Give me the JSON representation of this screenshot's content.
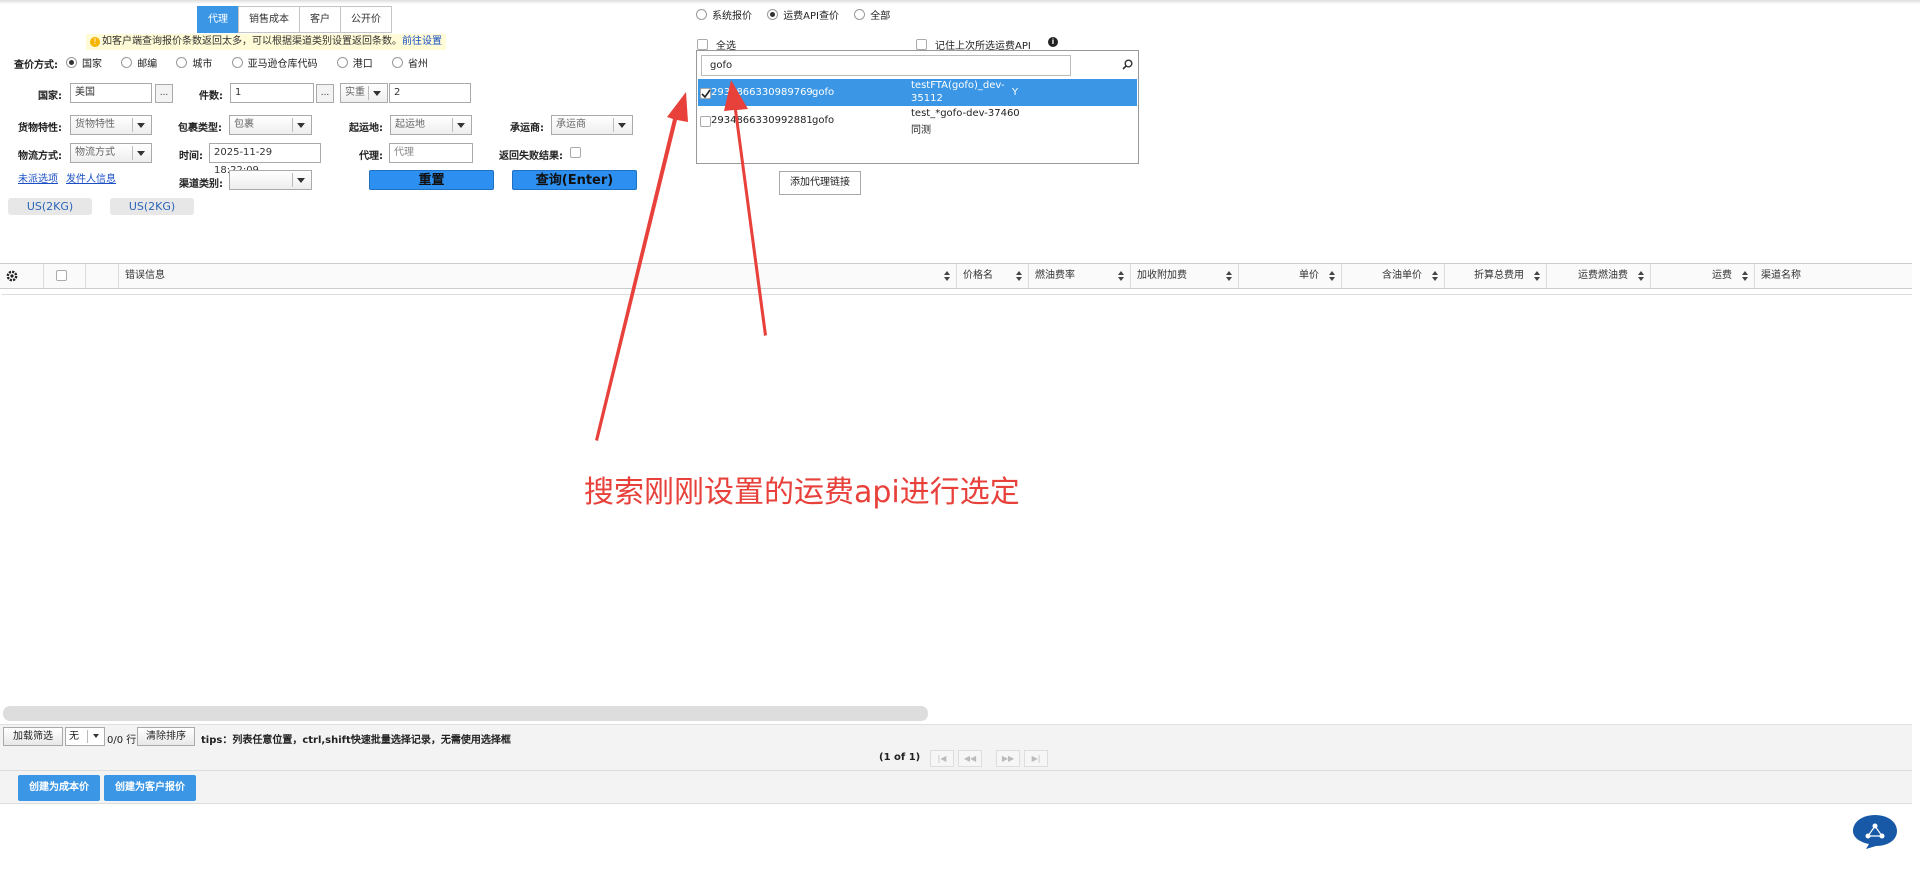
{
  "tabs": [
    "代理",
    "销售成本",
    "客户",
    "公开价"
  ],
  "notice": {
    "text": "如客户端查询报价条数返回太多，可以根据渠道类别设置返回条数。",
    "link": "前往设置"
  },
  "query_mode": {
    "label": "查价方式:",
    "options": [
      "国家",
      "邮编",
      "城市",
      "亚马逊仓库代码",
      "港口",
      "省州"
    ],
    "selected": "国家"
  },
  "form": {
    "country_label": "国家:",
    "country_value": "美国",
    "pieces_label": "件数:",
    "pieces_value": "1",
    "weight_type": "实重",
    "weight_value": "2",
    "cargo_label": "货物特性:",
    "cargo_ph": "货物特性",
    "package_label": "包裹类型:",
    "package_value": "包裹",
    "origin_label": "起运地:",
    "origin_ph": "起运地",
    "carrier_label": "承运商:",
    "carrier_ph": "承运商",
    "logistics_label": "物流方式:",
    "logistics_ph": "物流方式",
    "time_label": "时间:",
    "time_value": "2025-11-29 18:22:09",
    "agent_label": "代理:",
    "agent_ph": "代理",
    "fail_label": "返回失败结果:",
    "channel_label": "渠道类别:",
    "dots": "...",
    "link1": "未派选项",
    "link2": "发件人信息",
    "reset": "重置",
    "query": "查询(Enter)",
    "unit1": "US(2KG)",
    "unit2": "US(2KG)"
  },
  "price_source": {
    "options": [
      "系统报价",
      "运费API查价",
      "全部"
    ],
    "selected": "运费API查价"
  },
  "api": {
    "select_all": "全选",
    "remember": "记住上次所选运费API",
    "search_value": "gofo",
    "add_link": "添加代理链接",
    "rows": [
      {
        "id": "2934866330989769",
        "name": "gofo",
        "desc1": "testFTA(gofo)_dev-",
        "desc2": "35112",
        "flag": "Y",
        "selected": true
      },
      {
        "id": "2934866330992881",
        "name": "gofo",
        "desc1": "test_*gofo-dev-37460",
        "desc2": "同测",
        "flag": "",
        "selected": false
      }
    ]
  },
  "grid": {
    "columns": [
      "错误信息",
      "价格名",
      "燃油费率",
      "加收附加费",
      "单价",
      "含油单价",
      "折算总费用",
      "运费燃油费",
      "运费",
      "渠道名称"
    ]
  },
  "toolbar": {
    "filter": "加载筛选",
    "none": "无",
    "rows": "0/0 行",
    "clear_sort": "清除排序",
    "tips": "tips：列表任意位置，ctrl,shift快速批量选择记录，无需使用选择框",
    "pager": "(1 of 1)"
  },
  "footer": {
    "cost_btn": "创建为成本价",
    "customer_btn": "创建为客户报价"
  },
  "annotation": "搜索刚刚设置的运费api进行选定",
  "colors": {
    "primary": "#3b97e6",
    "annotation": "#e8403a"
  }
}
